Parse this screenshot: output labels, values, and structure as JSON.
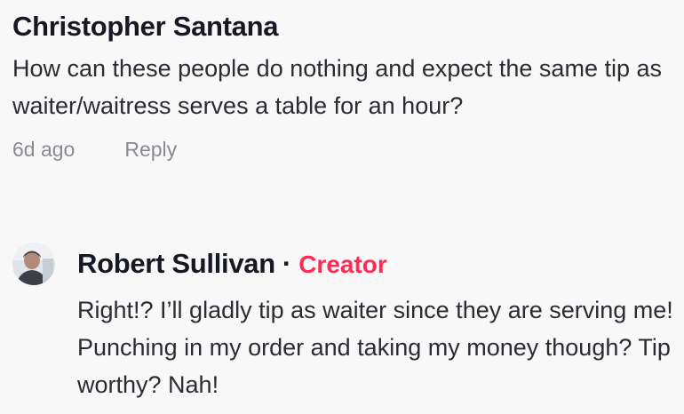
{
  "comment": {
    "author": "Christopher Santana",
    "text": "How can these people do nothing and expect the same tip as waiter/waitress serves a table for an hour?",
    "time": "6d ago",
    "reply_label": "Reply"
  },
  "reply": {
    "author": "Robert Sullivan",
    "separator": "·",
    "badge": "Creator",
    "badge_color": "#fe2c55",
    "text": "Right!? I’ll gladly tip as waiter since they are serving me! Punching in my order and taking my money though? Tip worthy? Nah!",
    "avatar_icon": "user-avatar-photo"
  }
}
